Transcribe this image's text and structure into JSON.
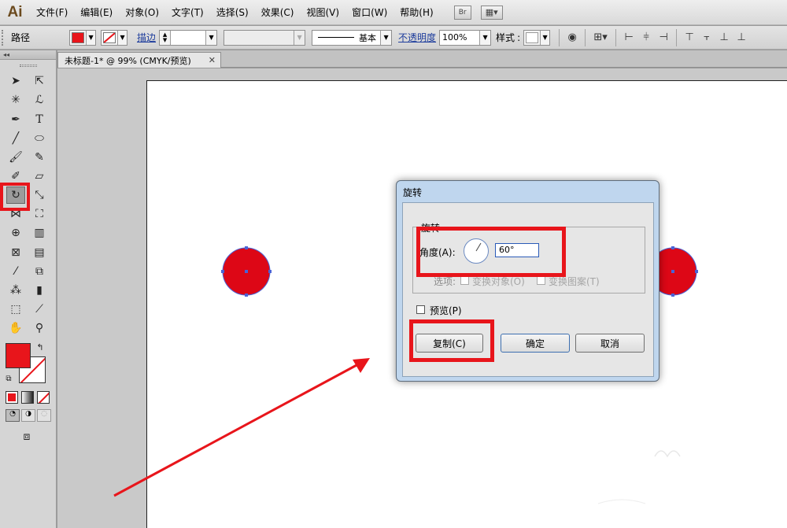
{
  "app": {
    "logo": "Ai"
  },
  "menu": {
    "items": [
      "文件(F)",
      "编辑(E)",
      "对象(O)",
      "文字(T)",
      "选择(S)",
      "效果(C)",
      "视图(V)",
      "窗口(W)",
      "帮助(H)"
    ],
    "bridge_label": "Br"
  },
  "control_bar": {
    "object_type": "路径",
    "fill_color": "#e8151b",
    "stroke_label": "描边",
    "stroke_profile": "基本",
    "opacity_label": "不透明度",
    "opacity_value": "100%",
    "style_label": "样式"
  },
  "document": {
    "tab_title": "未标题-1* @ 99% (CMYK/预览)",
    "close_glyph": "✕"
  },
  "dialog": {
    "title": "旋转",
    "group_title": "旋转",
    "angle_label": "角度(A):",
    "angle_value": "60°",
    "options_label": "选项:",
    "transform_objects": "变换对象(O)",
    "transform_patterns": "变换图案(T)",
    "preview_label": "预览(P)",
    "copy_button": "复制(C)",
    "ok_button": "确定",
    "cancel_button": "取消"
  },
  "colors": {
    "accent_red": "#e8151b",
    "circle_fill": "#dd0716",
    "anchor_blue": "#4a63d6"
  }
}
